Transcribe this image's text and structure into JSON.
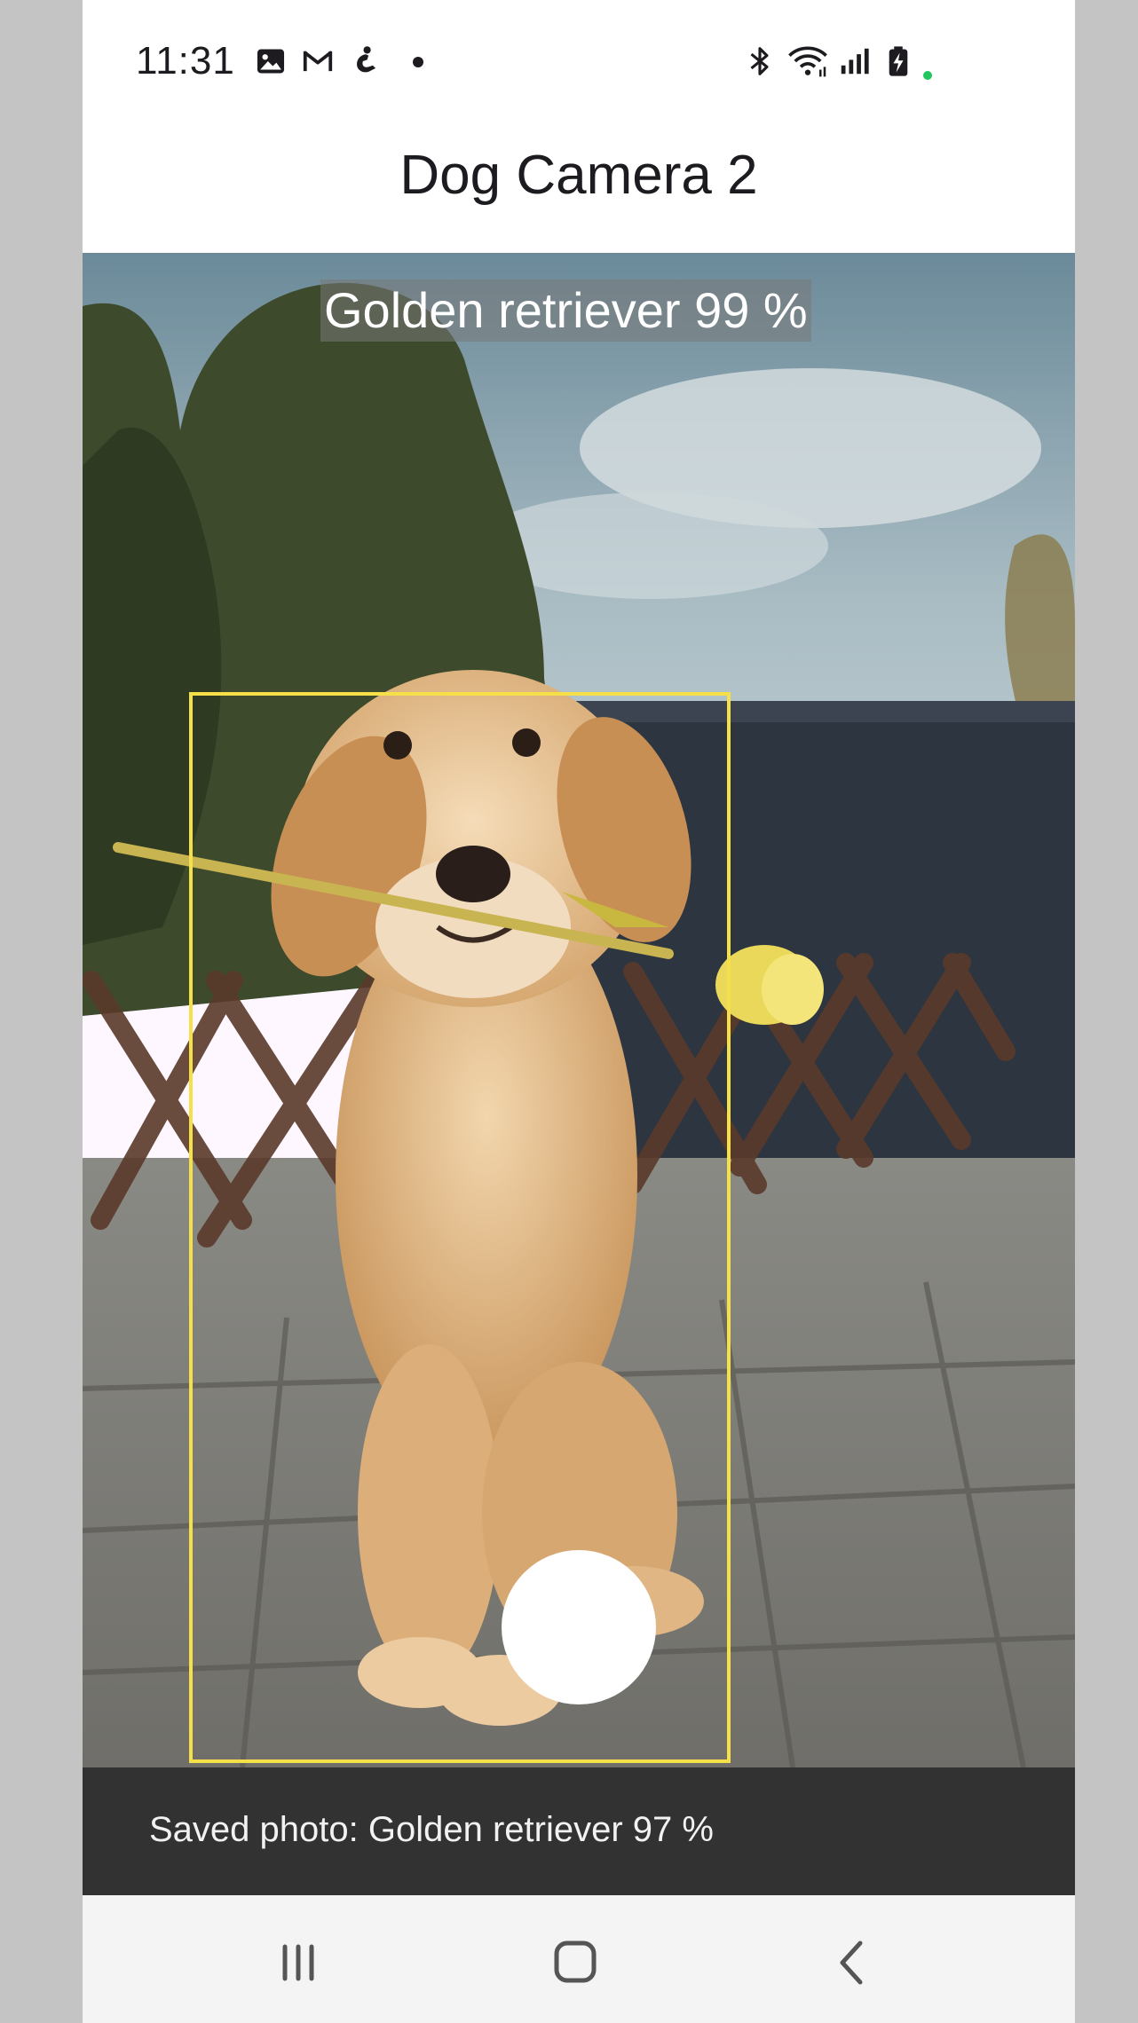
{
  "status_bar": {
    "time": "11:31",
    "left_icons": [
      "image-icon",
      "gmail-icon",
      "accessibility-icon",
      "dot-icon"
    ],
    "right_icons": [
      "bluetooth-icon",
      "wifi-icon",
      "signal-icon",
      "battery-charging-icon"
    ],
    "indicator_color": "#22c55e"
  },
  "app_bar": {
    "title": "Dog Camera 2"
  },
  "preview": {
    "detection_label": "Golden retriever 99 %",
    "box_color": "#f5e04a"
  },
  "snackbar": {
    "message": "Saved photo: Golden retriever 97 %"
  },
  "nav_bar": {
    "buttons": [
      "recent-apps",
      "home",
      "back"
    ]
  }
}
